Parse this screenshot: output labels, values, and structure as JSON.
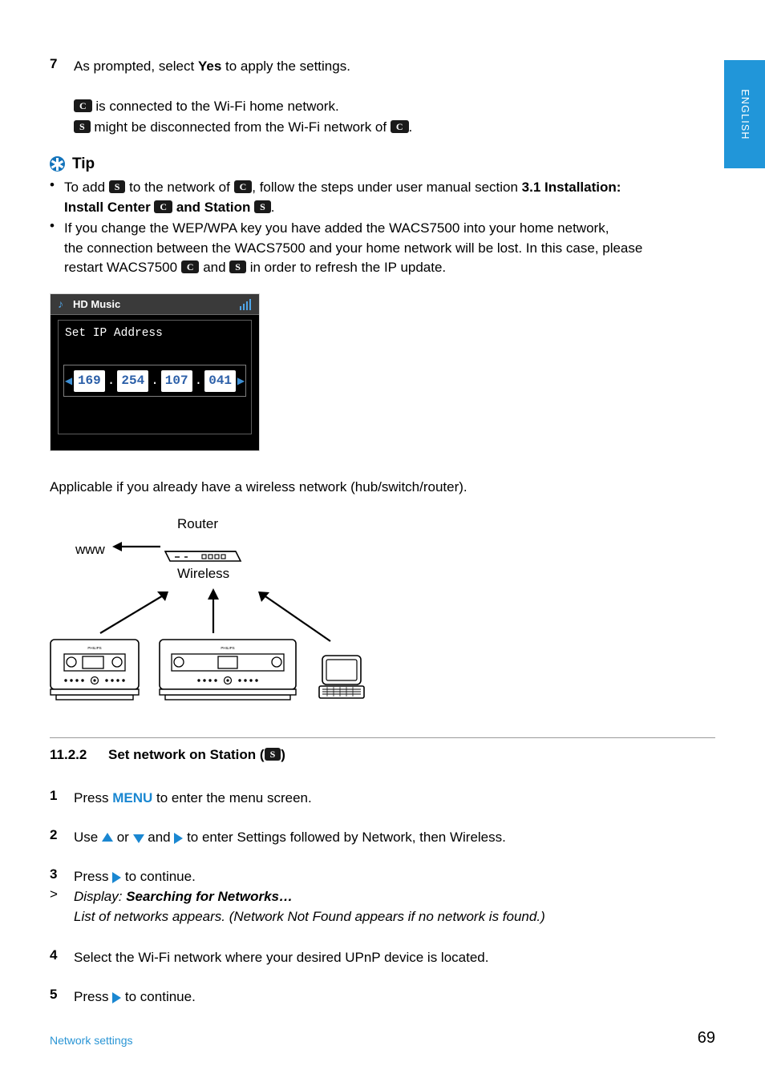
{
  "side_tab": {
    "label": "ENGLISH",
    "color": "#2196d9"
  },
  "step7": {
    "num": "7",
    "text_before": "As prompted, select ",
    "bold": "Yes",
    "text_after": " to apply the settings."
  },
  "status_lines": {
    "line1_badge": "C",
    "line1_text": " is connected to the Wi-Fi home network.",
    "line2_badge": "S",
    "line2_text_a": " might be disconnected from the Wi-Fi network of ",
    "line2_badge2": "C",
    "line2_text_b": "."
  },
  "tip": {
    "title": "Tip",
    "bullets": [
      {
        "a": "To add ",
        "badge1": "S",
        "b": " to the network of ",
        "badge2": "C",
        "c": ", follow the steps under user manual section ",
        "bold1": "3.1 Installation:",
        "bold2": "Install Center ",
        "badge3": "C",
        "bold3": " and Station ",
        "badge4": "S",
        "d": "."
      },
      {
        "line1": "If you change the WEP/WPA key you have added the WACS7500 into your home network,",
        "line2": "the connection between the WACS7500 and your home network will be lost. In this case, please",
        "line3_a": "restart WACS7500 ",
        "badge1": "C",
        "line3_b": " and ",
        "badge2": "S",
        "line3_c": " in order to refresh the IP update."
      }
    ]
  },
  "lcd": {
    "header_title": "HD Music",
    "note_icon": "music-note-icon",
    "signal_icon": "signal-bars-icon",
    "screen_label": "Set IP Address",
    "ip_segments": [
      "169",
      "254",
      "107",
      "041"
    ],
    "separator": ".",
    "left_arrow": "◀",
    "right_arrow": "▶"
  },
  "applicable_note": "Applicable if you already have a wireless network (hub/switch/router).",
  "diagram": {
    "www_label": "www",
    "router_label": "Router",
    "wireless_label": "Wireless",
    "center_brand": "PHILIPS",
    "station_brand": "PHILIPS"
  },
  "section": {
    "number": "11.2.2",
    "title_a": "Set network on Station (",
    "badge": "S",
    "title_b": ")"
  },
  "steps": [
    {
      "num": "1",
      "a": "Press ",
      "menu": "MENU",
      "b": " to enter the menu screen."
    },
    {
      "num": "2",
      "a": "Use ",
      "b": " or ",
      "c": " and ",
      "d": " to enter Settings followed by Network, then Wireless."
    },
    {
      "num": "3",
      "a": "Press ",
      "b": " to continue."
    },
    {
      "num": ">",
      "a": "Display: ",
      "bold": "Searching for Networks…",
      "sub": "List of networks appears. (Network Not Found appears if no network is found.)"
    },
    {
      "num": "4",
      "a": "Select the Wi-Fi network where your desired UPnP device is located."
    },
    {
      "num": "5",
      "a": "Press ",
      "b": " to continue."
    }
  ],
  "footer": {
    "left": "Network settings",
    "page": "69",
    "left_color": "#2a95d5"
  }
}
